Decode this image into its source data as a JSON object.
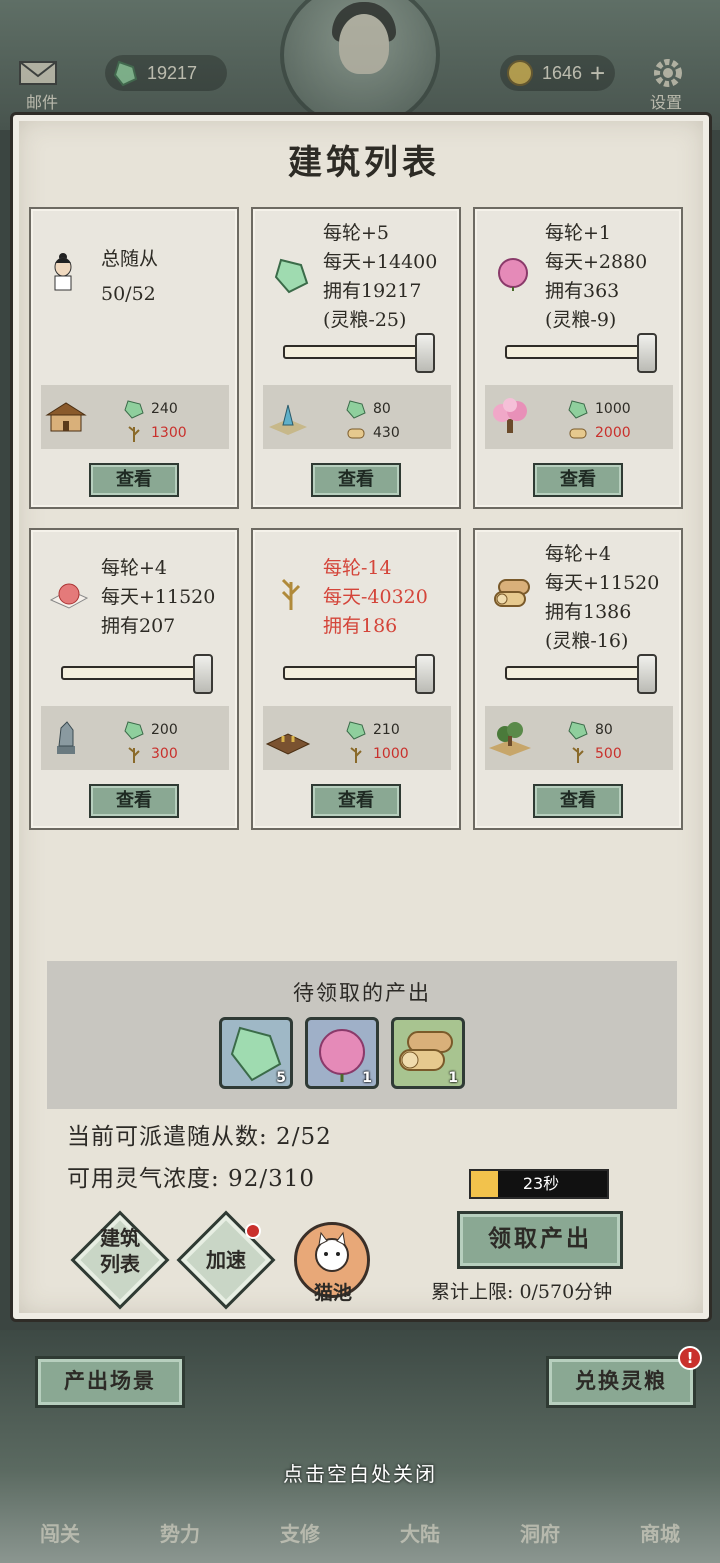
{
  "hud": {
    "mail_label": "邮件",
    "jade_count": "19217",
    "coin_count": "1646",
    "settings_label": "设置"
  },
  "panel_title": "建筑列表",
  "cards": [
    {
      "stats": [
        "总随从",
        "50/52"
      ],
      "cost_jade": "240",
      "cost_wood": "1300",
      "view": "查看"
    },
    {
      "stats": [
        "每轮+5",
        "每天+14400",
        "拥有19217",
        "(灵粮-25)"
      ],
      "cost_jade": "80",
      "cost_wood": "430",
      "view": "查看"
    },
    {
      "stats": [
        "每轮+1",
        "每天+2880",
        "拥有363",
        "(灵粮-9)"
      ],
      "cost_jade": "1000",
      "cost_wood": "2000",
      "view": "查看"
    },
    {
      "stats": [
        "每轮+4",
        "每天+11520",
        "拥有207"
      ],
      "cost_jade": "200",
      "cost_wood": "300",
      "view": "查看"
    },
    {
      "stats": [
        "每轮-14",
        "每天-40320",
        "拥有186"
      ],
      "cost_jade": "210",
      "cost_wood": "1000",
      "view": "查看"
    },
    {
      "stats": [
        "每轮+4",
        "每天+11520",
        "拥有1386",
        "(灵粮-16)"
      ],
      "cost_jade": "80",
      "cost_wood": "500",
      "view": "查看"
    }
  ],
  "pending": {
    "title": "待领取的产出",
    "items": [
      {
        "icon": "jade-icon",
        "count": "5"
      },
      {
        "icon": "peach-icon",
        "count": "1"
      },
      {
        "icon": "wood-icon",
        "count": "1"
      }
    ]
  },
  "info": {
    "dispatch": "当前可派遣随从数: 2/52",
    "qi": "可用灵气浓度: 92/310"
  },
  "timer": {
    "label": "23秒",
    "progress": 0.2
  },
  "claim_button": "领取产出",
  "limit_text": "累计上限: 0/570分钟",
  "actions": {
    "building_list": [
      "建筑",
      "列表"
    ],
    "speed_up": "加速",
    "cat_pool": "猫池"
  },
  "scene_button": "产出场景",
  "exchange_button": "兑换灵粮",
  "alert_badge": "!",
  "close_hint": "点击空白处关闭",
  "bottom_nav": [
    "闯关",
    "势力",
    "支修",
    "大陆",
    "洞府",
    "商城"
  ],
  "colors": {
    "accent_green": "#8aa893",
    "warning_red": "#d4453a",
    "timer_fill": "#f2c24c"
  }
}
